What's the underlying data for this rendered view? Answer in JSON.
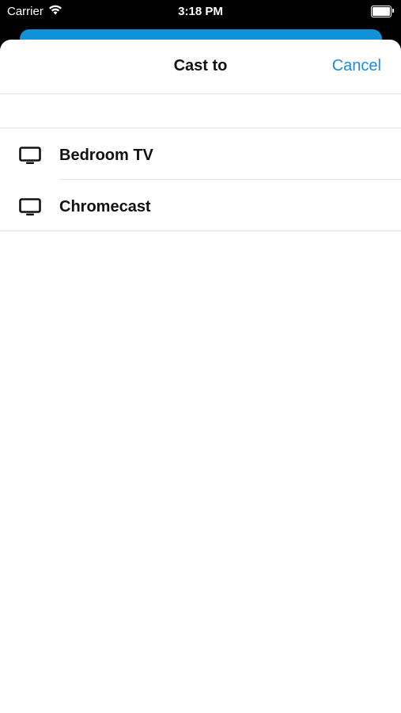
{
  "status_bar": {
    "carrier": "Carrier",
    "time": "3:18 PM",
    "wifi_icon": "wifi-icon",
    "battery_icon": "battery-icon"
  },
  "sheet": {
    "title": "Cast to",
    "cancel_label": "Cancel"
  },
  "devices": [
    {
      "label": "Bedroom TV",
      "icon": "tv-icon"
    },
    {
      "label": "Chromecast",
      "icon": "tv-icon"
    }
  ],
  "colors": {
    "accent": "#1a8be0",
    "behind_bar": "#1191d6"
  }
}
